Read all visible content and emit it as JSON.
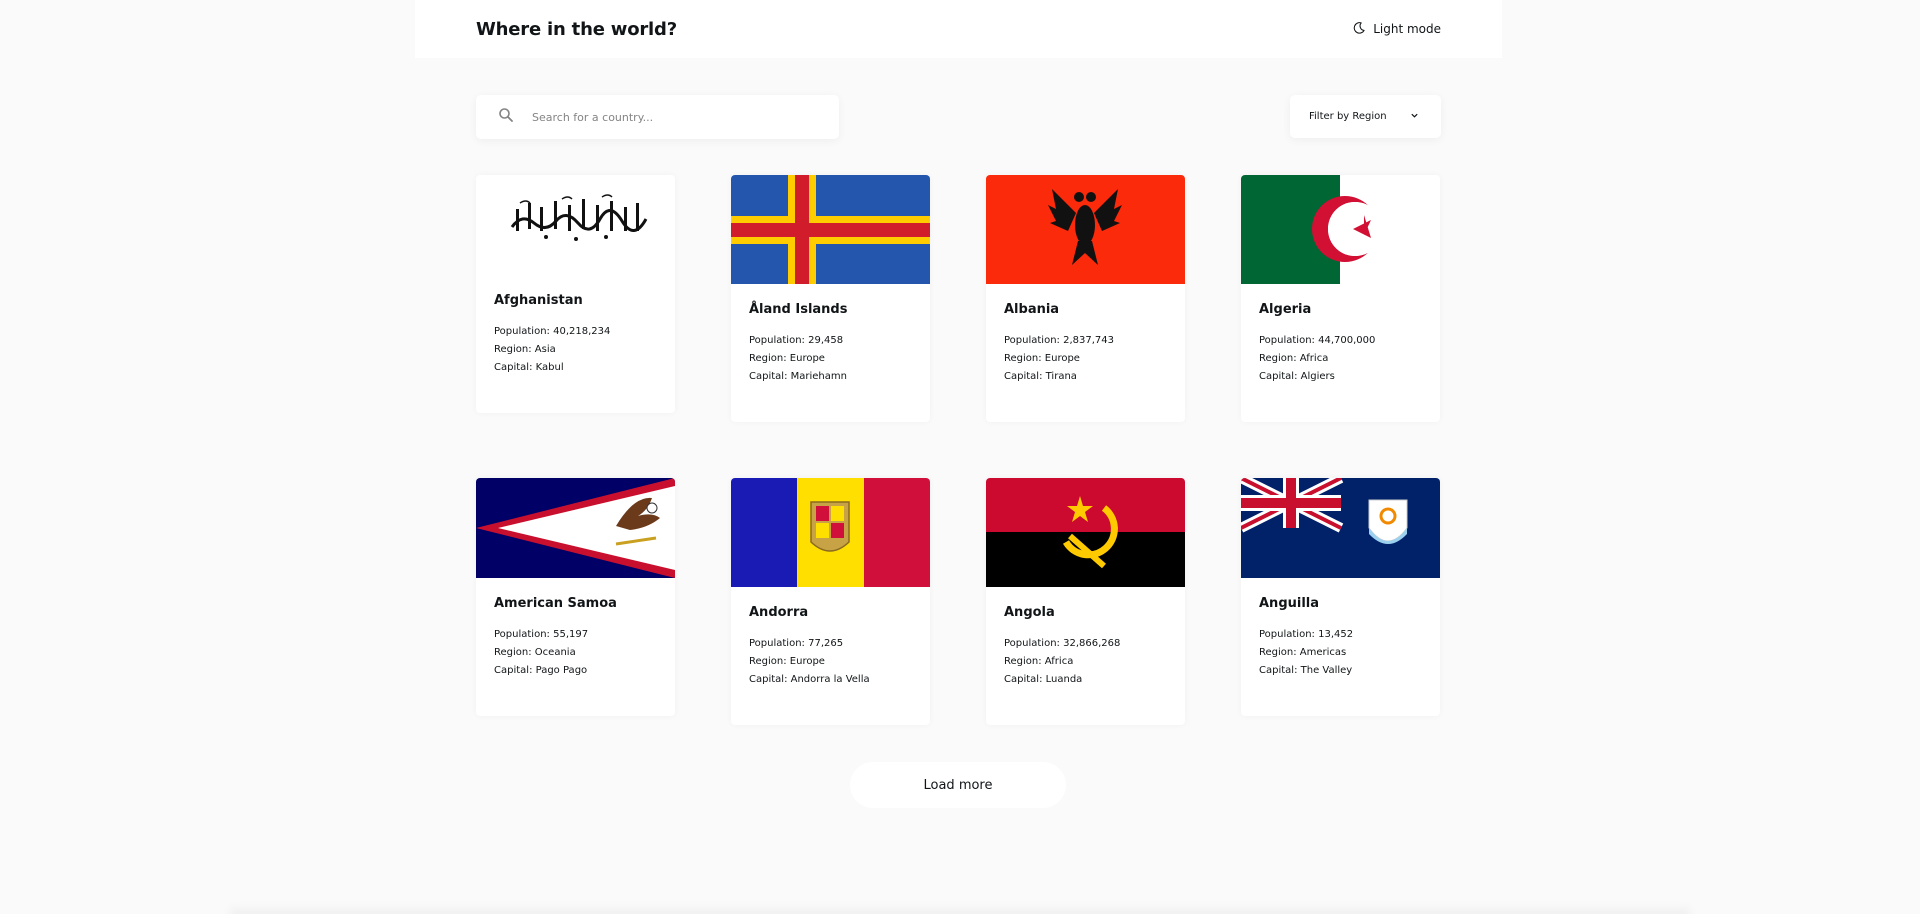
{
  "header": {
    "title": "Where in the world?",
    "mode_label": "Light mode"
  },
  "search": {
    "placeholder": "Search for a country...",
    "value": ""
  },
  "filter": {
    "label": "Filter by Region"
  },
  "labels": {
    "population": "Population:",
    "region": "Region:",
    "capital": "Capital:"
  },
  "countries": [
    {
      "name": "Afghanistan",
      "population": "40,218,234",
      "region": "Asia",
      "capital": "Kabul",
      "flag_icon": "afghanistan-flag-icon"
    },
    {
      "name": "Åland Islands",
      "population": "29,458",
      "region": "Europe",
      "capital": "Mariehamn",
      "flag_icon": "aland-islands-flag-icon"
    },
    {
      "name": "Albania",
      "population": "2,837,743",
      "region": "Europe",
      "capital": "Tirana",
      "flag_icon": "albania-flag-icon"
    },
    {
      "name": "Algeria",
      "population": "44,700,000",
      "region": "Africa",
      "capital": "Algiers",
      "flag_icon": "algeria-flag-icon"
    },
    {
      "name": "American Samoa",
      "population": "55,197",
      "region": "Oceania",
      "capital": "Pago Pago",
      "flag_icon": "american-samoa-flag-icon"
    },
    {
      "name": "Andorra",
      "population": "77,265",
      "region": "Europe",
      "capital": "Andorra la Vella",
      "flag_icon": "andorra-flag-icon"
    },
    {
      "name": "Angola",
      "population": "32,866,268",
      "region": "Africa",
      "capital": "Luanda",
      "flag_icon": "angola-flag-icon"
    },
    {
      "name": "Anguilla",
      "population": "13,452",
      "region": "Americas",
      "capital": "The Valley",
      "flag_icon": "anguilla-flag-icon"
    }
  ],
  "load_more": "Load more",
  "colors": {
    "background": "#fafafa",
    "card": "#ffffff",
    "text": "#111517",
    "placeholder": "#848484"
  }
}
